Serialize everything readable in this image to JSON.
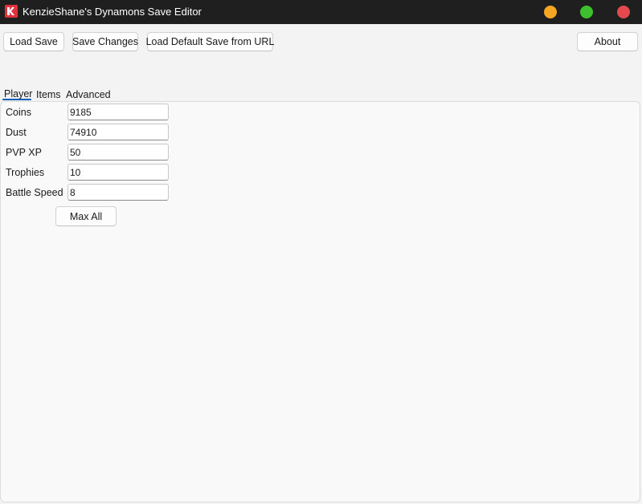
{
  "window": {
    "title": "KenzieShane's Dynamons Save Editor",
    "icon": "app-logo-icon",
    "controls": {
      "minimize_color": "#f5a623",
      "maximize_color": "#3dbf2e",
      "close_color": "#e5484d"
    }
  },
  "toolbar": {
    "load_save": "Load Save",
    "save_changes": "Save Changes",
    "load_default": "Load Default Save from URL",
    "about": "About"
  },
  "tabs": [
    {
      "label": "Player",
      "selected": true
    },
    {
      "label": "Items",
      "selected": false
    },
    {
      "label": "Advanced",
      "selected": false
    }
  ],
  "player": {
    "fields": [
      {
        "label": "Coins",
        "value": "9185"
      },
      {
        "label": "Dust",
        "value": "74910"
      },
      {
        "label": "PVP XP",
        "value": "50"
      },
      {
        "label": "Trophies",
        "value": "10"
      },
      {
        "label": "Battle Speed",
        "value": "8"
      }
    ],
    "max_all": "Max All"
  },
  "colors": {
    "titlebar": "#1f1f1f",
    "accent": "#005fb8"
  }
}
